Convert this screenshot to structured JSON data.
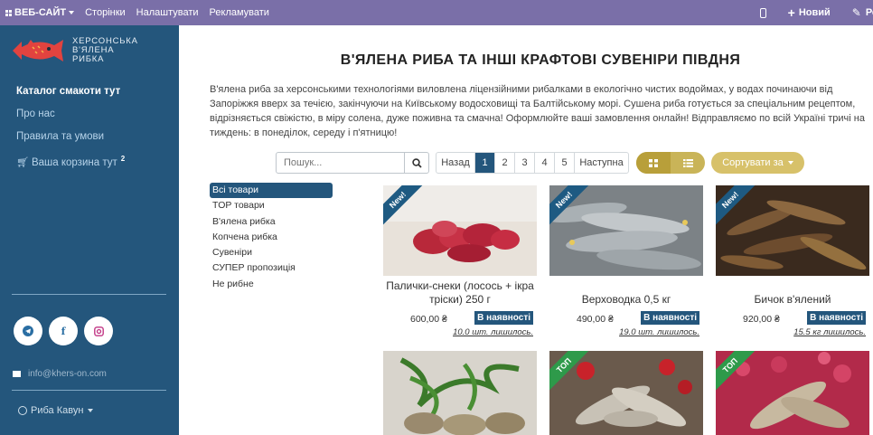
{
  "topbar": {
    "site_label": "ВЕБ-САЙТ",
    "menu": [
      "Сторінки",
      "Налаштувати",
      "Рекламувати"
    ],
    "new_label": "Новий",
    "edit_label": "Ред"
  },
  "sidebar": {
    "logo_lines": [
      "ХЕРСОНСЬКА",
      "В'ЯЛЕНА",
      "РИБКА"
    ],
    "nav": [
      {
        "label": "Каталог смакоти тут"
      },
      {
        "label": "Про нас"
      },
      {
        "label": "Правила та умови"
      },
      {
        "label": "Ваша корзина тут",
        "count": "2"
      }
    ],
    "email": "info@khers-on.com",
    "user": "Риба Кавун"
  },
  "main": {
    "title": "В'ЯЛЕНА РИБА ТА ІНШІ КРАФТОВІ СУВЕНІРИ ПІВДНЯ",
    "intro": "В'ялена риба за херсонськими технологіями виловлена ліцензійними рибалками в екологічно чистих водоймах, у водах починаючи від Запоріжжя вверх за течією, закінчуючи на Київському водосховищі та Балтійському морі.  Сушена риба готується за спеціальним рецептом, відрізняється свіжістю, в міру солена, дуже поживна та смачна! Оформлюйте ваші замовлення онлайн! Відправляємо по всій Україні тричі на тиждень: в понеділок, середу і п'ятницю!"
  },
  "search": {
    "placeholder": "Пошук..."
  },
  "pager": {
    "prev": "Назад",
    "pages": [
      "1",
      "2",
      "3",
      "4",
      "5"
    ],
    "current": "1",
    "next": "Наступна"
  },
  "sort_label": "Сортувати за",
  "categories": [
    "Всі товари",
    "TOP товари",
    "В'ялена рибка",
    "Копчена рибка",
    "Сувеніри",
    "СУПЕР пропозиція",
    "Не рибне"
  ],
  "products": [
    {
      "name": "Палички-снеки (лосось + ікра тріски) 250 г",
      "price": "600,00 ₴",
      "stock": "В наявності",
      "left": "10.0 шт. лишилось.",
      "badge": "New!"
    },
    {
      "name": "Верховодка 0,5 кг",
      "price": "490,00 ₴",
      "stock": "В наявності",
      "left": "19.0 шт. лишилось.",
      "badge": "New!"
    },
    {
      "name": "Бичок в'ялений",
      "price": "920,00 ₴",
      "stock": "В наявності",
      "left": "15.5 кг лишилось.",
      "badge": "New!"
    },
    {
      "badge": "",
      "name": "",
      "price": "",
      "stock": "",
      "left": ""
    },
    {
      "badge": "ТОП",
      "name": "",
      "price": "",
      "stock": "",
      "left": ""
    },
    {
      "badge": "ТОП",
      "name": "",
      "price": "",
      "stock": "",
      "left": ""
    }
  ],
  "colors": {
    "topbar": "#7a6fa8",
    "sidebar": "#24567c",
    "accent_gold": "#c9b458",
    "badge_new": "#1e5a82",
    "badge_top": "#2e9a4a"
  }
}
